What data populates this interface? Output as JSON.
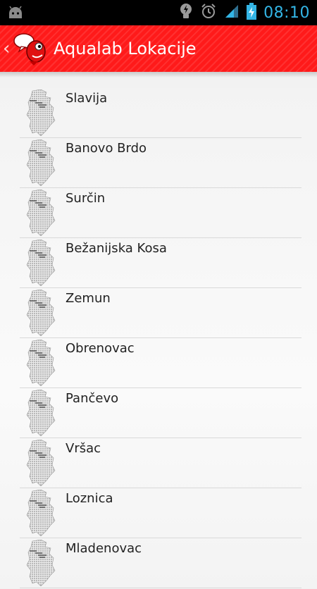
{
  "status_bar": {
    "time": "08:10",
    "icons": [
      "android-notification-icon",
      "tips-bulb-icon",
      "alarm-clock-icon",
      "signal-icon",
      "battery-charging-icon"
    ],
    "accent_color": "#33b5e5"
  },
  "action_bar": {
    "title": "Aqualab Lokacije",
    "background_color": "#ff1a1a",
    "up_icon": "chevron-left-icon",
    "app_icon": "aqualab-fish-logo"
  },
  "locations": [
    {
      "name": "Slavija"
    },
    {
      "name": "Banovo Brdo"
    },
    {
      "name": "Surčin"
    },
    {
      "name": "Bežanijska Kosa"
    },
    {
      "name": "Zemun"
    },
    {
      "name": "Obrenovac"
    },
    {
      "name": "Pančevo"
    },
    {
      "name": "Vršac"
    },
    {
      "name": "Loznica"
    },
    {
      "name": "Mladenovac"
    }
  ],
  "list_icon": "serbia-map-icon"
}
